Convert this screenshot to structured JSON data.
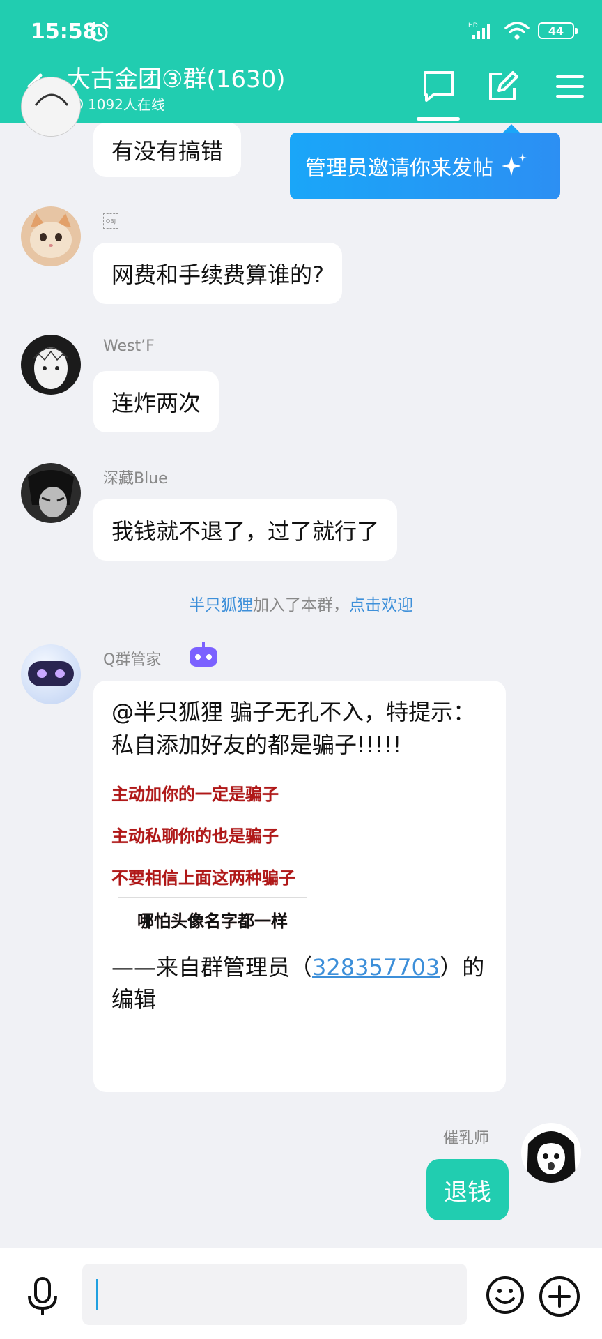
{
  "status_bar": {
    "time": "15:58",
    "battery": "44"
  },
  "header": {
    "title": "大古金团③群(1630)",
    "online": "1092人在线"
  },
  "tooltip": {
    "text": "管理员邀请你来发帖"
  },
  "messages": [
    {
      "sender": "",
      "text": "有没有搞错"
    },
    {
      "sender": "",
      "text": "网费和手续费算谁的?"
    },
    {
      "sender": "West’F",
      "text": "连炸两次"
    },
    {
      "sender": "深藏Blue",
      "text": "我钱就不退了，过了就行了"
    }
  ],
  "system": {
    "name": "半只狐狸",
    "middle": "加入了本群，",
    "action": "点击欢迎"
  },
  "bot": {
    "sender": "Q群管家",
    "text": "@半只狐狸 骗子无孔不入，特提示：私自添加好友的都是骗子!!!!!",
    "notice_lines": [
      "主动加你的一定是骗子",
      "主动私聊你的也是骗子",
      "不要相信上面这两种骗子",
      "哪怕头像名字都一样"
    ],
    "footer_prefix": "——来自群管理员（",
    "footer_qq": "328357703",
    "footer_suffix": "）的编辑"
  },
  "mine": {
    "sender": "催乳师",
    "text": "退钱"
  },
  "colors": {
    "accent": "#21cdb0",
    "link": "#3d8fd9",
    "background": "#f0f1f5"
  }
}
